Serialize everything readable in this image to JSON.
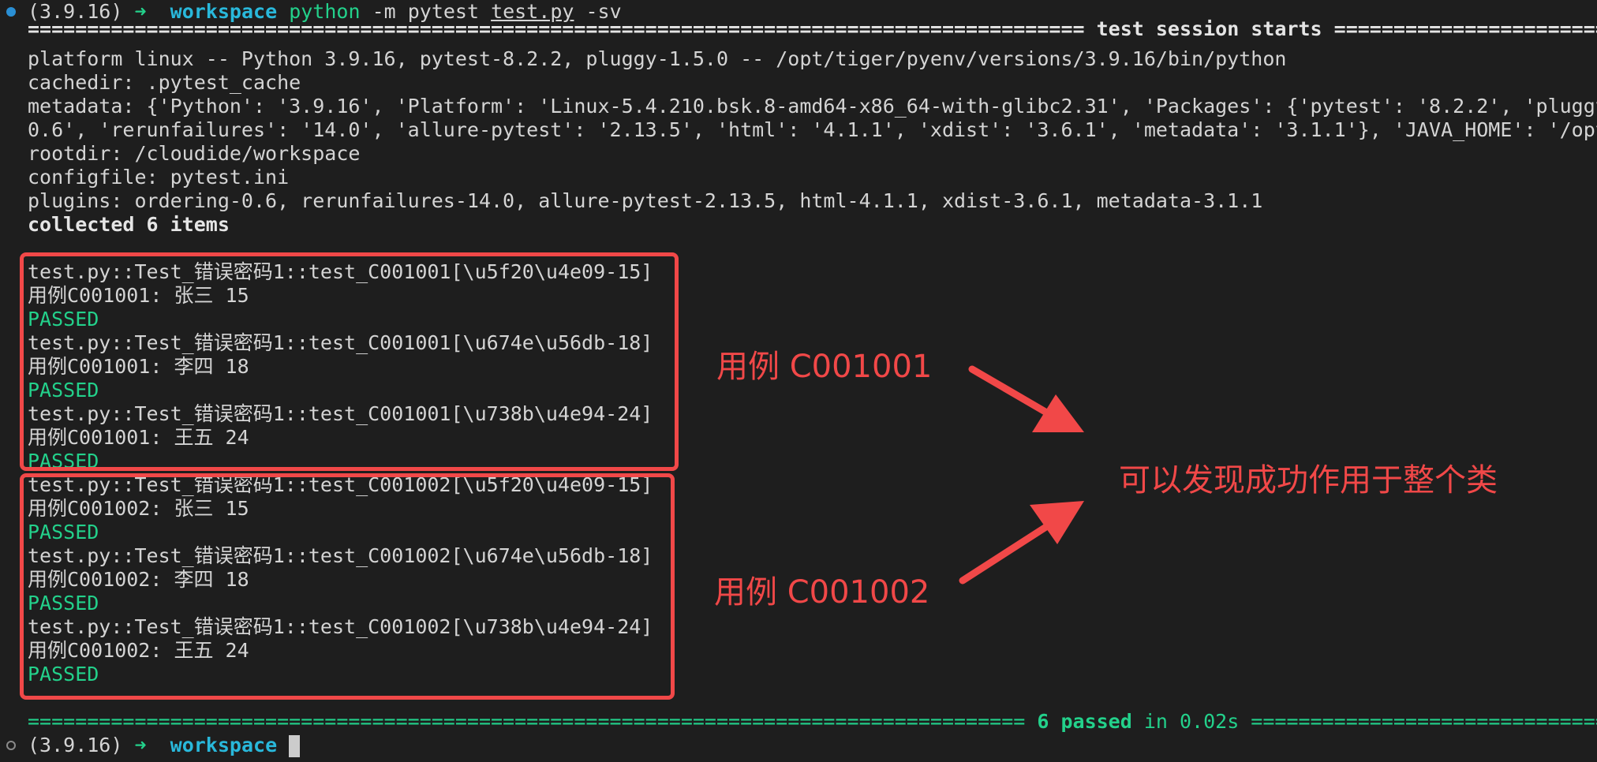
{
  "prompt_top": {
    "env": "(3.9.16)",
    "arrow": "➜",
    "dir": "workspace",
    "cmd": "python",
    "args_a": "-m pytest ",
    "file": "test.py",
    "args_b": " -sv"
  },
  "session_header": {
    "left_rule": "=========================================================================================",
    "title": " test session starts ",
    "right_rule": "=========================================================================================="
  },
  "info_lines": [
    "platform linux -- Python 3.9.16, pytest-8.2.2, pluggy-1.5.0 -- /opt/tiger/pyenv/versions/3.9.16/bin/python",
    "cachedir: .pytest_cache",
    "metadata: {'Python': '3.9.16', 'Platform': 'Linux-5.4.210.bsk.8-amd64-x86_64-with-glibc2.31', 'Packages': {'pytest': '8.2.2', 'pluggy",
    "0.6', 'rerunfailures': '14.0', 'allure-pytest': '2.13.5', 'html': '4.1.1', 'xdist': '3.6.1', 'metadata': '3.1.1'}, 'JAVA_HOME': '/opt",
    "rootdir: /cloudide/workspace",
    "configfile: pytest.ini",
    "plugins: ordering-0.6, rerunfailures-14.0, allure-pytest-2.13.5, html-4.1.1, xdist-3.6.1, metadata-3.1.1"
  ],
  "collected": "collected 6 items",
  "results": [
    {
      "test": "test.py::Test_错误密码1::test_C001001[\\u5f20\\u4e09-15]",
      "output": "用例C001001: 张三 15",
      "status": "PASSED"
    },
    {
      "test": "test.py::Test_错误密码1::test_C001001[\\u674e\\u56db-18]",
      "output": "用例C001001: 李四 18",
      "status": "PASSED"
    },
    {
      "test": "test.py::Test_错误密码1::test_C001001[\\u738b\\u4e94-24]",
      "output": "用例C001001: 王五 24",
      "status": "PASSED"
    },
    {
      "test": "test.py::Test_错误密码1::test_C001002[\\u5f20\\u4e09-15]",
      "output": "用例C001002: 张三 15",
      "status": "PASSED"
    },
    {
      "test": "test.py::Test_错误密码1::test_C001002[\\u674e\\u56db-18]",
      "output": "用例C001002: 李四 18",
      "status": "PASSED"
    },
    {
      "test": "test.py::Test_错误密码1::test_C001002[\\u738b\\u4e94-24]",
      "output": "用例C001002: 王五 24",
      "status": "PASSED"
    }
  ],
  "summary": {
    "left_rule": "==================================================================================== ",
    "passed": "6 passed",
    "time": " in 0.02s ",
    "right_rule": "===================================================================================="
  },
  "prompt_bottom": {
    "env": "(3.9.16)",
    "arrow": "➜",
    "dir": "workspace"
  },
  "annotations": {
    "label_1": "用例 C001001",
    "label_2": "用例 C001002",
    "conclusion": "可以发现成功作用于整个类"
  },
  "colors": {
    "background": "#1e1e1e",
    "pass_green": "#23d18b",
    "dir_cyan": "#29b8db",
    "annotation_red": "#f14848",
    "prompt_dot_top": "#2a8fd4"
  }
}
